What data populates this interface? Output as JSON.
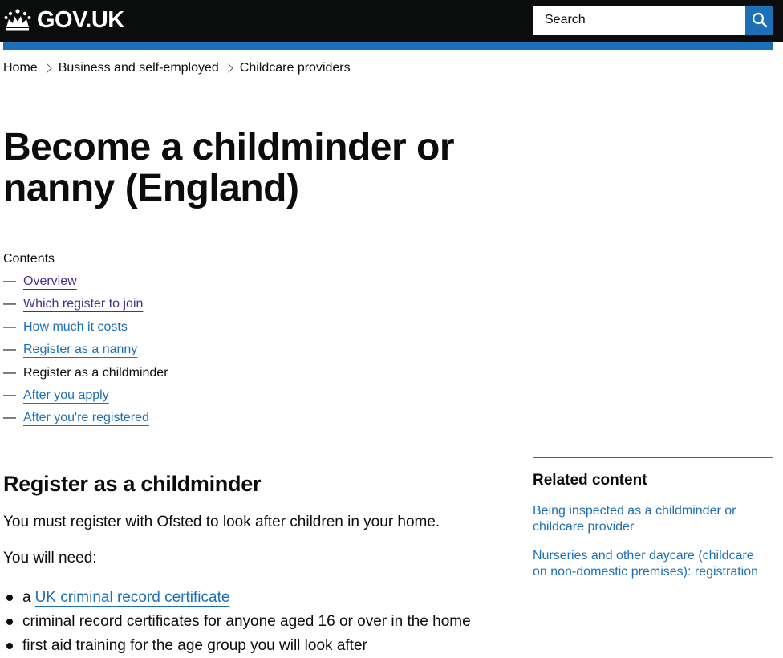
{
  "header": {
    "logo_text": "GOV.UK",
    "search_placeholder": "Search",
    "logo_icon": "crown-icon",
    "search_icon": "search-icon"
  },
  "colors": {
    "header_bg": "#0b0c0c",
    "brand_blue": "#1d70b8",
    "link": "#1d70b8",
    "visited_link": "#4c2c92",
    "text": "#0b0c0c"
  },
  "breadcrumbs": [
    {
      "label": "Home"
    },
    {
      "label": "Business and self-employed"
    },
    {
      "label": "Childcare providers"
    }
  ],
  "page": {
    "title": "Become a childminder or nanny (England)"
  },
  "contents": {
    "label": "Contents",
    "items": [
      {
        "label": "Overview",
        "state": "visited"
      },
      {
        "label": "Which register to join",
        "state": "visited"
      },
      {
        "label": "How much it costs",
        "state": "link"
      },
      {
        "label": "Register as a nanny",
        "state": "link"
      },
      {
        "label": "Register as a childminder",
        "state": "current"
      },
      {
        "label": "After you apply",
        "state": "link"
      },
      {
        "label": "After you're registered",
        "state": "link"
      }
    ]
  },
  "section": {
    "heading": "Register as a childminder",
    "intro": "You must register with Ofsted to look after children in your home.",
    "need": "You will need:",
    "bullets": [
      {
        "prefix": "a",
        "link": "UK criminal record certificate"
      },
      {
        "text": "criminal record certificates for anyone aged 16 or over in the home"
      },
      {
        "text": "first aid training for the age group you will look after"
      }
    ]
  },
  "related": {
    "heading": "Related content",
    "links": [
      "Being inspected as a childminder or childcare provider",
      "Nurseries and other daycare (childcare on non-domestic premises): registration"
    ]
  }
}
